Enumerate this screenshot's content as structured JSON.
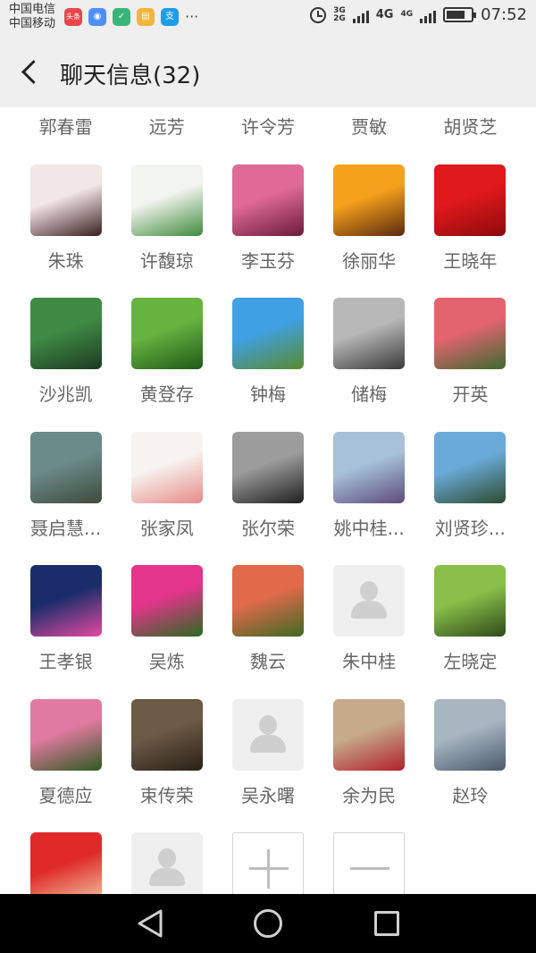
{
  "status_bar": {
    "carrier_1": "中国电信",
    "carrier_2": "中国移动",
    "app_icons": [
      {
        "name": "toutiao-icon",
        "glyph": "头条",
        "color": "#e8474a"
      },
      {
        "name": "browser-icon",
        "glyph": "◉",
        "color": "#4f8ff5"
      },
      {
        "name": "security-icon",
        "glyph": "✓",
        "color": "#3ab57a"
      },
      {
        "name": "app-store-icon",
        "glyph": "▤",
        "color": "#f4b33b"
      },
      {
        "name": "alipay-icon",
        "glyph": "支",
        "color": "#1d9cf0"
      }
    ],
    "more_icon": "···",
    "network_1": [
      "3G",
      "2G"
    ],
    "network_2": "4G",
    "network_3": "4G",
    "time": "07:52"
  },
  "header": {
    "back_icon": "chevron-left-icon",
    "title": "聊天信息(32)"
  },
  "members": [
    {
      "name": "郭春雷",
      "avatar_colors": [
        "#c28a2a",
        "#4a3a22"
      ]
    },
    {
      "name": "远芳",
      "avatar_colors": [
        "#d9b983",
        "#8a6a3a"
      ]
    },
    {
      "name": "许令芳",
      "avatar_colors": [
        "#6a8cb0",
        "#2f3f55"
      ]
    },
    {
      "name": "贾敏",
      "avatar_colors": [
        "#6a8a3c",
        "#c94a6a"
      ]
    },
    {
      "name": "胡贤芝",
      "avatar_colors": [
        "#b8a487",
        "#7d6a55"
      ]
    },
    {
      "name": "朱珠",
      "avatar_colors": [
        "#f3e6e6",
        "#3a1f1f"
      ]
    },
    {
      "name": "许馥琼",
      "avatar_colors": [
        "#f2f4ef",
        "#3f8a3c"
      ]
    },
    {
      "name": "李玉芬",
      "avatar_colors": [
        "#e06a96",
        "#6a1b3a"
      ]
    },
    {
      "name": "徐丽华",
      "avatar_colors": [
        "#f6a11c",
        "#5a2a10"
      ]
    },
    {
      "name": "王晓年",
      "avatar_colors": [
        "#e0191c",
        "#8c0a0c"
      ]
    },
    {
      "name": "沙兆凯",
      "avatar_colors": [
        "#3f8a44",
        "#1e3a24"
      ]
    },
    {
      "name": "黄登存",
      "avatar_colors": [
        "#67b340",
        "#1e5a18"
      ]
    },
    {
      "name": "钟梅",
      "avatar_colors": [
        "#3fa0e3",
        "#5a8a2e"
      ]
    },
    {
      "name": "储梅",
      "avatar_colors": [
        "#b8b8b8",
        "#3a3a3a"
      ]
    },
    {
      "name": "开英",
      "avatar_colors": [
        "#e3646f",
        "#3c6a2e"
      ]
    },
    {
      "name": "聂启慧...",
      "avatar_colors": [
        "#6b8a8a",
        "#3e4a3a"
      ]
    },
    {
      "name": "张家凤",
      "avatar_colors": [
        "#f7f4ef",
        "#e68a8a"
      ]
    },
    {
      "name": "张尔荣",
      "avatar_colors": [
        "#9c9c9c",
        "#1f1f1f"
      ]
    },
    {
      "name": "姚中桂...",
      "avatar_colors": [
        "#a7c2d8",
        "#5d4a7d"
      ]
    },
    {
      "name": "刘贤珍...",
      "avatar_colors": [
        "#6aaad8",
        "#2e4a2e"
      ]
    },
    {
      "name": "王孝银",
      "avatar_colors": [
        "#1a2d6a",
        "#e54aa0"
      ]
    },
    {
      "name": "吴炼",
      "avatar_colors": [
        "#e3358a",
        "#2a6a20"
      ]
    },
    {
      "name": "魏云",
      "avatar_colors": [
        "#e06a4a",
        "#3e6a22"
      ]
    },
    {
      "name": "朱中桂",
      "avatar_colors": [],
      "default": true
    },
    {
      "name": "左晓定",
      "avatar_colors": [
        "#8ac04a",
        "#2e4a1a"
      ]
    },
    {
      "name": "夏德应",
      "avatar_colors": [
        "#e07aa0",
        "#2e5a22"
      ]
    },
    {
      "name": "束传荣",
      "avatar_colors": [
        "#6b5a45",
        "#2a2018"
      ]
    },
    {
      "name": "吴永曙",
      "avatar_colors": [],
      "default": true
    },
    {
      "name": "余为民",
      "avatar_colors": [
        "#c6ab8a",
        "#b0202a"
      ]
    },
    {
      "name": "赵玲",
      "avatar_colors": [
        "#a8b6c2",
        "#4a5a6a"
      ]
    },
    {
      "name": "",
      "avatar_colors": [
        "#e02a2a",
        "#f0c8a0"
      ]
    },
    {
      "name": "",
      "avatar_colors": [],
      "default": true
    }
  ],
  "actions": {
    "add_icon": "plus-icon",
    "remove_icon": "minus-icon"
  },
  "nav": {
    "back_icon": "triangle-back-icon",
    "home_icon": "circle-home-icon",
    "recent_icon": "square-recent-icon"
  }
}
